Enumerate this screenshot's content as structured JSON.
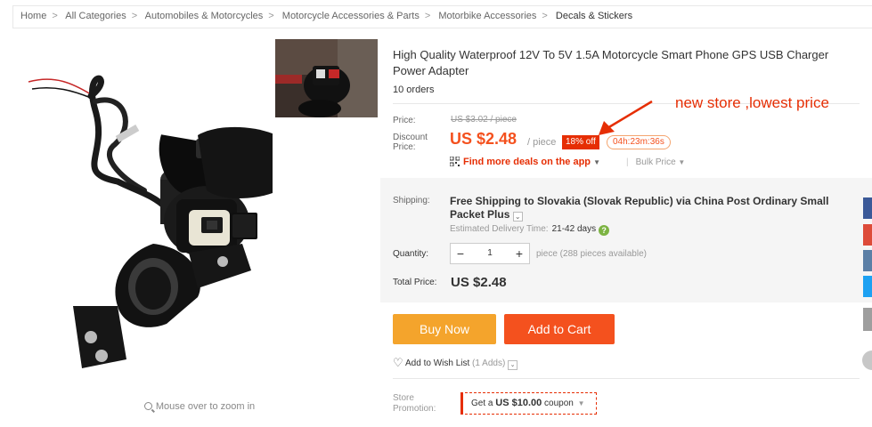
{
  "breadcrumb": {
    "items": [
      "Home",
      "All Categories",
      "Automobiles & Motorcycles",
      "Motorcycle Accessories & Parts",
      "Motorbike Accessories"
    ],
    "current": "Decals & Stickers",
    "separator": ">"
  },
  "gallery": {
    "zoom_hint": "Mouse over to zoom in"
  },
  "product": {
    "title": "High Quality Waterproof 12V To 5V 1.5A Motorcycle Smart Phone GPS USB Charger Power Adapter",
    "orders": "10 orders"
  },
  "price": {
    "price_label": "Price:",
    "original": "US $3.02 / piece",
    "discount_label_1": "Discount",
    "discount_label_2": "Price:",
    "discount": "US $2.48",
    "per_piece": "/ piece",
    "off_badge": "18% off",
    "timer": "04h:23m:36s",
    "app_deals": "Find more deals on the app",
    "bulk": "Bulk Price"
  },
  "annotation": {
    "text": "new store ,lowest price"
  },
  "shipping": {
    "label": "Shipping:",
    "text": "Free Shipping to Slovakia (Slovak Republic) via China Post Ordinary Small Packet Plus",
    "est_label": "Estimated Delivery Time:",
    "est_days": "21-42 days"
  },
  "quantity": {
    "label": "Quantity:",
    "value": "1",
    "minus": "−",
    "plus": "+",
    "available": "piece (288 pieces available)"
  },
  "total": {
    "label": "Total Price:",
    "value": "US $2.48"
  },
  "actions": {
    "buy_now": "Buy Now",
    "add_to_cart": "Add to Cart",
    "wish_list": "Add to Wish List",
    "wish_adds": "(1 Adds)"
  },
  "promotion": {
    "label_1": "Store",
    "label_2": "Promotion:",
    "coupon_prefix": "Get a",
    "coupon_amount": "US $10.00",
    "coupon_suffix": "coupon"
  },
  "colors": {
    "accent": "#f4511e",
    "buy_now": "#f4a42c",
    "badge": "#e62e04",
    "facebook": "#3b5998",
    "googleplus": "#dd4b39",
    "vk": "#5b7fa6",
    "twitter": "#1da1f2"
  },
  "icons": {
    "zoom": "magnifier-icon",
    "qr": "qr-code-icon",
    "help": "question-icon",
    "heart": "heart-icon"
  }
}
